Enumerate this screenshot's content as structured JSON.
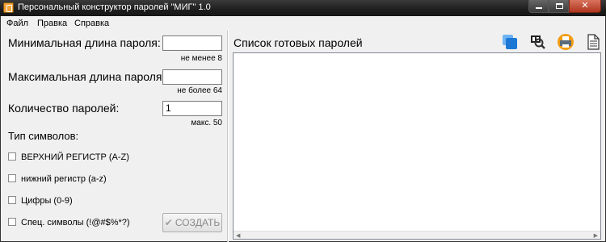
{
  "window": {
    "title": "Персональный конструктор паролей \"МИГ\" 1.0"
  },
  "menu": {
    "file": "Файл",
    "edit": "Правка",
    "help": "Справка"
  },
  "form": {
    "min_length": {
      "label": "Минимальная длина пароля:",
      "value": "",
      "hint": "не менее 8"
    },
    "max_length": {
      "label": "Максимальная длина пароля:",
      "value": "",
      "hint": "не более 64"
    },
    "count": {
      "label": "Количество паролей:",
      "value": "1",
      "hint": "макс. 50"
    },
    "char_types_label": "Тип символов:",
    "char_types": [
      {
        "label": "ВЕРХНИЙ РЕГИСТР (A-Z)",
        "checked": false
      },
      {
        "label": "нижний регистр (a-z)",
        "checked": false
      },
      {
        "label": "Цифры (0-9)",
        "checked": false
      },
      {
        "label": "Спец. символы (!@#$%*?)",
        "checked": false
      }
    ],
    "create_button": "СОЗДАТЬ",
    "create_button_enabled": false
  },
  "output": {
    "title": "Список готовых паролей",
    "content": "",
    "toolbar": [
      "copy-icon",
      "search-icon",
      "print-icon",
      "document-icon"
    ]
  },
  "colors": {
    "titlebar": "#1e1e1e",
    "window_bg": "#f0f0f0",
    "close_button": "#c9452d",
    "accent_blue": "#1c78d4",
    "print_orange": "#f39c12"
  }
}
